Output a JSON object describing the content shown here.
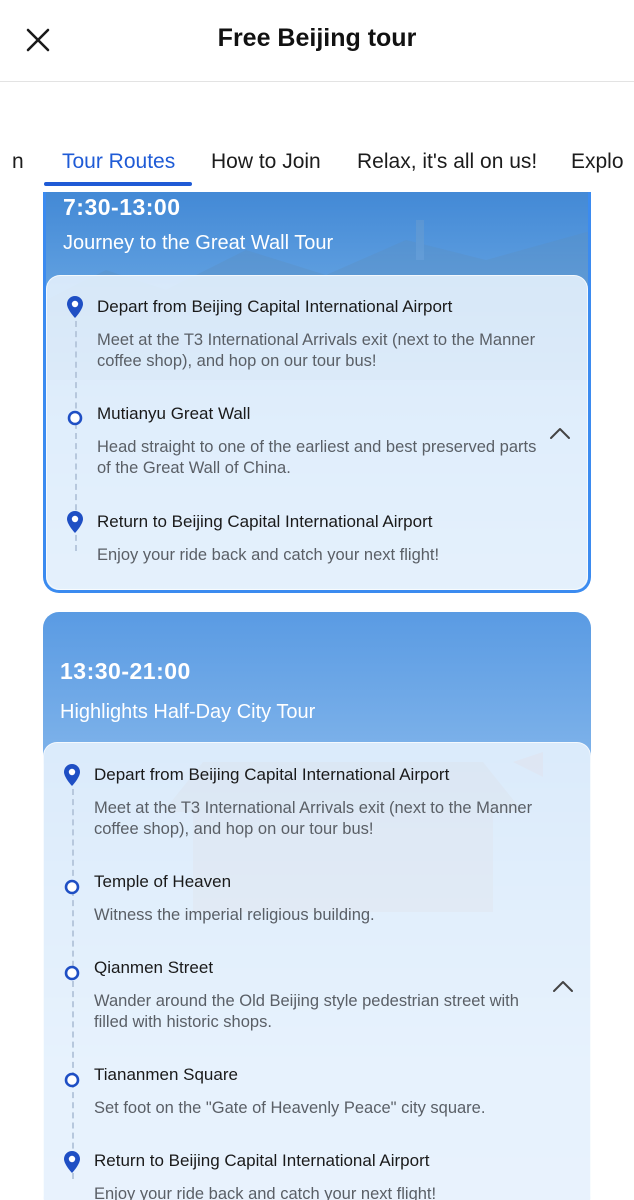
{
  "header": {
    "title": "Free Beijing tour"
  },
  "tabs": [
    {
      "label": "n"
    },
    {
      "label": "Tour Routes"
    },
    {
      "label": "How to Join"
    },
    {
      "label": "Relax, it's all on us!"
    },
    {
      "label": "Explo"
    }
  ],
  "routes": [
    {
      "time": "7:30-13:00",
      "title": "Journey to the Great Wall Tour",
      "stops": [
        {
          "name": "Depart from Beijing Capital International Airport",
          "desc": "Meet at the T3 International Arrivals exit (next to the Manner coffee shop), and hop on our tour bus!",
          "icon": "location-pin-icon"
        },
        {
          "name": "Mutianyu Great Wall",
          "desc": "Head straight to one of the earliest and best preserved parts of the Great Wall of China.",
          "icon": "circle-dot-icon"
        },
        {
          "name": "Return to Beijing Capital International Airport",
          "desc": "Enjoy your ride back and catch your next flight!",
          "icon": "location-pin-icon"
        }
      ]
    },
    {
      "time": "13:30-21:00",
      "title": "Highlights Half-Day City Tour",
      "stops": [
        {
          "name": "Depart from Beijing Capital International Airport",
          "desc": "Meet at the T3 International Arrivals exit (next to the Manner coffee shop), and hop on our tour bus!",
          "icon": "location-pin-icon"
        },
        {
          "name": "Temple of Heaven",
          "desc": "Witness the imperial religious building.",
          "icon": "circle-dot-icon"
        },
        {
          "name": "Qianmen Street",
          "desc": "Wander around the Old Beijing style pedestrian street with filled with historic shops.",
          "icon": "circle-dot-icon"
        },
        {
          "name": "Tiananmen Square",
          "desc": "Set foot on the \"Gate of Heavenly Peace\" city square.",
          "icon": "circle-dot-icon"
        },
        {
          "name": "Return to Beijing Capital International Airport",
          "desc": "Enjoy your ride back and catch your next flight!",
          "icon": "location-pin-icon"
        }
      ]
    }
  ],
  "colors": {
    "accent": "#1f5bd6",
    "card_border": "#3b8bf0"
  }
}
